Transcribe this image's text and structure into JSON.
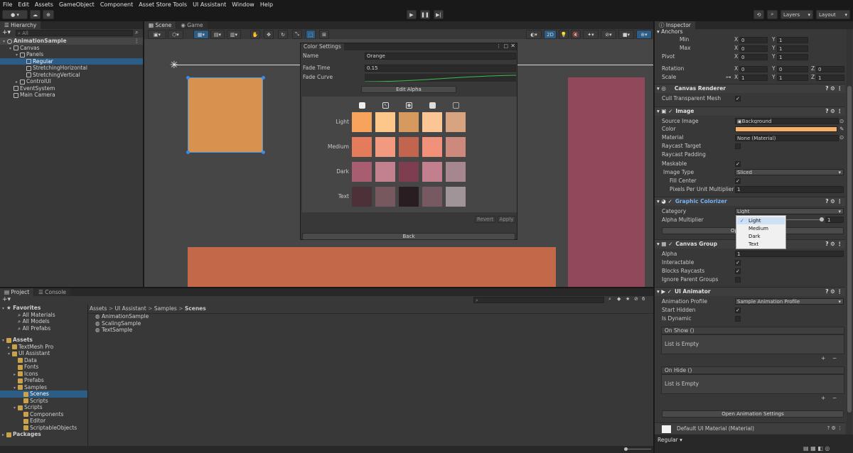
{
  "menu": [
    "File",
    "Edit",
    "Assets",
    "GameObject",
    "Component",
    "Asset Store Tools",
    "UI Assistant",
    "Window",
    "Help"
  ],
  "toolbar": {
    "layers": "Layers",
    "layout": "Layout",
    "play_icon": "play-icon",
    "pause_icon": "pause-icon",
    "step_icon": "step-icon"
  },
  "hierarchy": {
    "tab": "Hierarchy",
    "search_placeholder": "All",
    "items": [
      {
        "label": "AnimationSample",
        "indent": 0,
        "kind": "scene"
      },
      {
        "label": "Canvas",
        "indent": 1,
        "kind": "go"
      },
      {
        "label": "Panels",
        "indent": 2,
        "kind": "go"
      },
      {
        "label": "Regular",
        "indent": 3,
        "kind": "go"
      },
      {
        "label": "StretchingHorizontal",
        "indent": 3,
        "kind": "go"
      },
      {
        "label": "StretchingVertical",
        "indent": 3,
        "kind": "go"
      },
      {
        "label": "ControlUI",
        "indent": 2,
        "kind": "go"
      },
      {
        "label": "EventSystem",
        "indent": 1,
        "kind": "go"
      },
      {
        "label": "Main Camera",
        "indent": 1,
        "kind": "go"
      }
    ]
  },
  "scene": {
    "tabs": [
      "Scene",
      "Game"
    ],
    "mode_2d": "2D"
  },
  "color_settings": {
    "title": "Color Settings",
    "name_label": "Name",
    "name_value": "Orange",
    "fade_time_label": "Fade Time",
    "fade_time_value": "0.15",
    "fade_curve_label": "Fade Curve",
    "edit_alpha": "Edit Alpha",
    "rows": [
      {
        "label": "Light",
        "colors": [
          "#f7a35c",
          "#fbc78a",
          "#d69a5f",
          "#fcc595",
          "#d8a47f"
        ]
      },
      {
        "label": "Medium",
        "colors": [
          "#e47b5a",
          "#f19a7f",
          "#c2654e",
          "#f29179",
          "#cd897b"
        ]
      },
      {
        "label": "Dark",
        "colors": [
          "#a95d70",
          "#c3808f",
          "#7f3e4f",
          "#c2808f",
          "#a6868f"
        ]
      },
      {
        "label": "Text",
        "colors": [
          "#4c3138",
          "#78585f",
          "#2a1d21",
          "#775a61",
          "#a09498"
        ]
      }
    ],
    "revert": "Revert",
    "apply": "Apply",
    "back": "Back"
  },
  "project": {
    "tabs": [
      "Project",
      "Console"
    ],
    "favorites": "Favorites",
    "fav_items": [
      "All Materials",
      "All Models",
      "All Prefabs"
    ],
    "assets": "Assets",
    "tree": [
      {
        "label": "TextMesh Pro",
        "indent": 1
      },
      {
        "label": "UI Assistant",
        "indent": 1
      },
      {
        "label": "Data",
        "indent": 2
      },
      {
        "label": "Fonts",
        "indent": 2
      },
      {
        "label": "Icons",
        "indent": 2
      },
      {
        "label": "Prefabs",
        "indent": 2
      },
      {
        "label": "Samples",
        "indent": 2
      },
      {
        "label": "Scenes",
        "indent": 3
      },
      {
        "label": "Scripts",
        "indent": 3
      },
      {
        "label": "Scripts",
        "indent": 2
      },
      {
        "label": "Components",
        "indent": 3
      },
      {
        "label": "Editor",
        "indent": 3
      },
      {
        "label": "ScriptableObjects",
        "indent": 3
      }
    ],
    "packages": "Packages",
    "breadcrumb": [
      "Assets",
      "UI Assistant",
      "Samples",
      "Scenes"
    ],
    "files": [
      "AnimationSample",
      "ScalingSample",
      "TextSample"
    ],
    "count": "6"
  },
  "inspector": {
    "tab": "Inspector",
    "anchors": "Anchors",
    "min": "Min",
    "max": "Max",
    "pivot": "Pivot",
    "rotation": "Rotation",
    "scale": "Scale",
    "min_vals": [
      "0",
      "1"
    ],
    "max_vals": [
      "0",
      "1"
    ],
    "pivot_vals": [
      "0",
      "1"
    ],
    "rot_vals": [
      "0",
      "0",
      "0"
    ],
    "scale_vals": [
      "1",
      "1",
      "1"
    ],
    "canvas_renderer": "Canvas Renderer",
    "cull": "Cull Transparent Mesh",
    "image": "Image",
    "source_image": "Source Image",
    "source_value": "Background",
    "color": "Color",
    "color_value": "#f7b06a",
    "material": "Material",
    "material_value": "None (Material)",
    "raycast_target": "Raycast Target",
    "raycast_padding": "Raycast Padding",
    "maskable": "Maskable",
    "image_type": "Image Type",
    "image_type_value": "Sliced",
    "fill_center": "Fill Center",
    "ppu": "Pixels Per Unit Multiplier",
    "ppu_value": "1",
    "graphic_colorizer": "Graphic Colorizer",
    "category": "Category",
    "category_value": "Light",
    "alpha_mult": "Alpha Multiplier",
    "alpha_value": "1",
    "dropdown": [
      "Light",
      "Medium",
      "Dark",
      "Text"
    ],
    "open_btn": "Op",
    "canvas_group": "Canvas Group",
    "alpha": "Alpha",
    "alpha_cg": "1",
    "interactable": "Interactable",
    "blocks_raycasts": "Blocks Raycasts",
    "ignore_parent": "Ignore Parent Groups",
    "ui_animator": "UI Animator",
    "anim_profile": "Animation Profile",
    "anim_profile_value": "Sample Animation Profile",
    "start_hidden": "Start Hidden",
    "is_dynamic": "Is Dynamic",
    "on_show": "On Show ()",
    "on_hide": "On Hide ()",
    "list_empty": "List is Empty",
    "open_anim": "Open Animation Settings",
    "default_mat": "Default UI Material (Material)",
    "footer": "Regular"
  }
}
